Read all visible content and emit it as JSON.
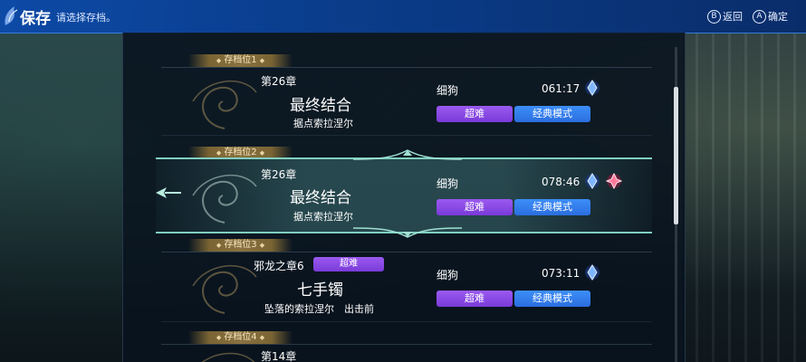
{
  "header": {
    "title": "保存",
    "subtitle": "请选择存档。",
    "hints": [
      {
        "button": "B",
        "label": "返回"
      },
      {
        "button": "A",
        "label": "确定"
      }
    ]
  },
  "slots": [
    {
      "tab": "存档位1",
      "chapter": "第26章",
      "title": "最终结合",
      "location": "据点索拉涅尔",
      "name": "细狗",
      "time": "061:17",
      "badges": [
        "超难",
        "经典模式"
      ],
      "gems": [
        "blue"
      ]
    },
    {
      "tab": "存档位2",
      "chapter": "第26章",
      "title": "最终结合",
      "location": "据点索拉涅尔",
      "name": "细狗",
      "time": "078:46",
      "badges": [
        "超难",
        "经典模式"
      ],
      "gems": [
        "blue",
        "red"
      ],
      "selected": true
    },
    {
      "tab": "存档位3",
      "chapter": "邪龙之章6",
      "chapter_badge": "超难",
      "title": "七手镯",
      "location": "坠落的索拉涅尔",
      "location_extra": "出击前",
      "name": "细狗",
      "time": "073:11",
      "badges": [
        "超难",
        "经典模式"
      ],
      "gems": [
        "blue"
      ]
    },
    {
      "tab": "存档位4",
      "chapter": "第14章",
      "title": "",
      "location": "",
      "name": "",
      "time": "",
      "badges": [],
      "gems": []
    }
  ],
  "colors": {
    "header": "#0a3d8c",
    "badge_purple": "#8a4ae6",
    "badge_blue": "#3580ef",
    "selected_line": "#7fcfc0",
    "tab_gold": "#8a7240"
  }
}
